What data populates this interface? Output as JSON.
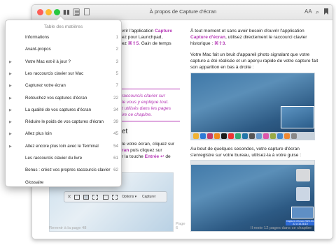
{
  "window": {
    "title": "À propos de Capture d'écran",
    "toolbar_right": {
      "font_size": "AA",
      "search": "⌕",
      "bookmark": "▾"
    }
  },
  "toc": {
    "title": "Table des matières",
    "items": [
      {
        "label": "Informations",
        "page": "1",
        "expandable": false
      },
      {
        "label": "Avant-propos",
        "page": "2",
        "expandable": false
      },
      {
        "label": "Votre Mac est-il à jour ?",
        "page": "3",
        "expandable": true
      },
      {
        "label": "Les raccourcis clavier sur Mac",
        "page": "5",
        "expandable": true
      },
      {
        "label": "Capturez votre écran",
        "page": "7",
        "expandable": true
      },
      {
        "label": "Retouchez vos captures d'écran",
        "page": "22",
        "expandable": true
      },
      {
        "label": "La qualité de vos captures d'écran",
        "page": "34",
        "expandable": true
      },
      {
        "label": "Réduire le poids de vos captures d'écran",
        "page": "39",
        "expandable": true
      },
      {
        "label": "Allez plus loin",
        "page": "45",
        "expandable": true
      },
      {
        "label": "Allez encore plus loin avec le Terminal",
        "page": "54",
        "expandable": true
      },
      {
        "label": "Les raccourcis clavier du livre",
        "page": "61",
        "expandable": false
      },
      {
        "label": "Bonus : créez vos propres raccourcis clavier",
        "page": "62",
        "expandable": false
      },
      {
        "label": "Glossaire",
        "page": "",
        "expandable": false
      }
    ]
  },
  "left_page": {
    "p1_a": "vrir l'application ",
    "p1_hl": "Capture",
    "p2": "ez pour Launchpad,",
    "p3_a": "ez ",
    "p3_hl": "⌘⇧5",
    "p3_b": ". Gain de temps",
    "note1": "raccourcis clavier sur",
    "note2": "le vous y explique tout.",
    "note3": "t utilisés dans les pages",
    "note4": "ire ce chapitre.",
    "heading": "et",
    "q1": "le votre écran, cliquez sur",
    "q2_hl": "ran",
    "q2": " puis cliquez sur",
    "q3_a": "r la touche ",
    "q3_hl": "Entrée ↩",
    "q3_b": " de",
    "toolbar_options": "Options ▾",
    "toolbar_capture": "Capturer",
    "footer": "Revenir à la page 48",
    "page_num": "Page 6"
  },
  "right_page": {
    "p1": "À tout moment et sans avoir besoin d'ouvrir l'application",
    "p2_hl": "Capture d'écran",
    "p2": ", utilisez directement le raccourci clavier",
    "p3_a": "historique : ",
    "p3_hl": "⌘⇧3",
    "p3_b": ".",
    "p4": "Votre Mac fait un bruit d'appareil photo signalant que votre",
    "p5": "capture a été réalisée et un aperçu rapide de votre capture fait",
    "p6": "son apparition en bas à droite :",
    "p7": "Au bout de quelques secondes, votre capture d'écran",
    "p8": "s'enregistre sur votre bureau, utilisez-la à votre guise :",
    "desk_file_label": "Capture d'écran 2020-04-22 à 15.28.10",
    "footer": "Il reste 12 pages dans ce chapitre"
  },
  "colors": {
    "accent": "#b535b5",
    "desktop_blue": "#2b5d8a",
    "light_red": "#ff5f57",
    "light_yellow": "#febc2e",
    "light_green": "#28c840"
  }
}
